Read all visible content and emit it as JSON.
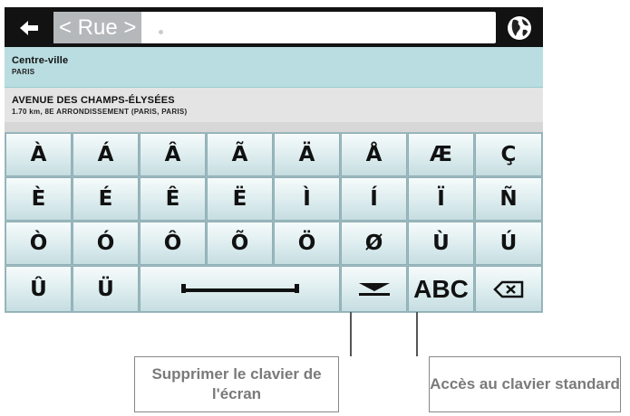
{
  "search": {
    "placeholder": "< Rue >"
  },
  "results": [
    {
      "title": "Centre-ville",
      "subtitle": "PARIS"
    },
    {
      "title": "AVENUE DES CHAMPS-ÉLYSÉES",
      "subtitle": "1.70 km, 8E ARRONDISSEMENT (PARIS, PARIS)"
    }
  ],
  "keyboard": {
    "rows": [
      [
        "À",
        "Á",
        "Â",
        "Ã",
        "Ä",
        "Å",
        "Æ",
        "Ç"
      ],
      [
        "È",
        "É",
        "Ê",
        "Ë",
        "Ì",
        "Í",
        "Ï",
        "Ñ"
      ],
      [
        "Ò",
        "Ó",
        "Ô",
        "Õ",
        "Ö",
        "Ø",
        "Ù",
        "Ú"
      ]
    ],
    "bottom_row": [
      "Û",
      "Ü"
    ],
    "abc_label": "ABC"
  },
  "icons": [
    "back-arrow-icon",
    "globe-icon",
    "space-bar-icon",
    "hide-keyboard-icon",
    "backspace-icon"
  ],
  "callouts": {
    "hide_keyboard": "Supprimer le clavier de l'écran",
    "standard_keyboard": "Accès au clavier standard"
  },
  "colors": {
    "keyboard_bg": "#9db9bf",
    "result_highlight": "#b9dde0",
    "top_bar": "#121212"
  }
}
